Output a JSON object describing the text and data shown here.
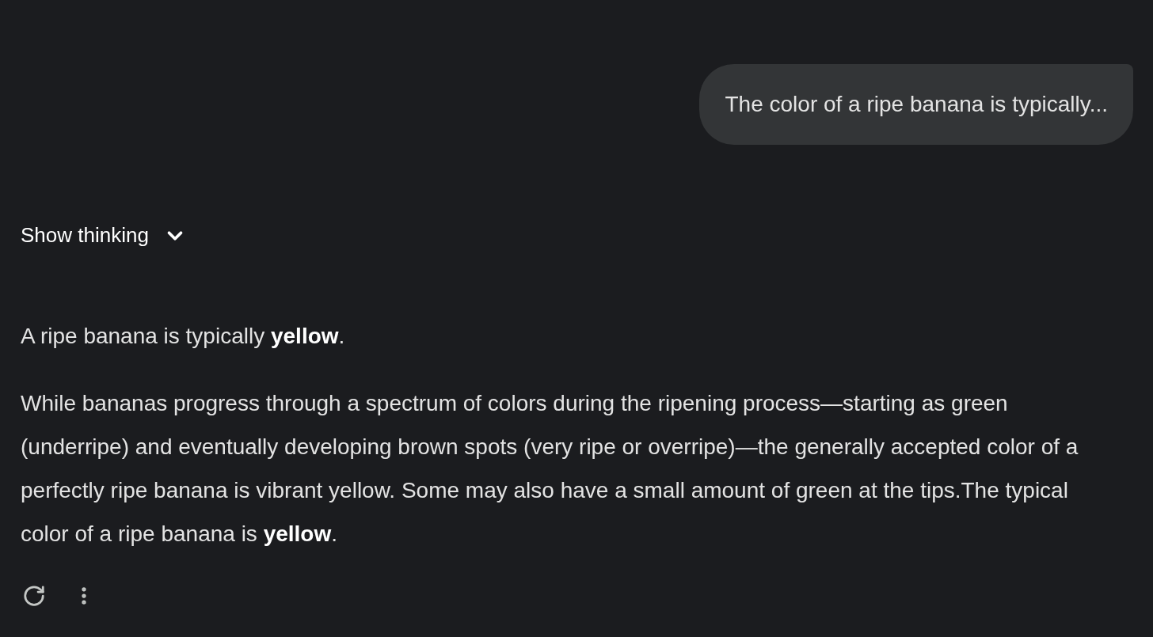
{
  "user_message": "The color of a ripe banana is typically...",
  "thinking_toggle": {
    "label": "Show thinking",
    "expanded": false
  },
  "response": {
    "paragraphs": [
      "A ripe banana is typically **yellow**.",
      "While bananas progress through a spectrum of colors during the ripening process—starting as green (underripe) and eventually developing brown spots (very ripe or overripe)—the generally accepted color of a perfectly ripe banana is vibrant yellow. Some may also have a small amount of green at the tips.The typical color of a ripe banana is **yellow**."
    ]
  },
  "actions": [
    {
      "kind": "regenerate"
    },
    {
      "kind": "more"
    }
  ]
}
